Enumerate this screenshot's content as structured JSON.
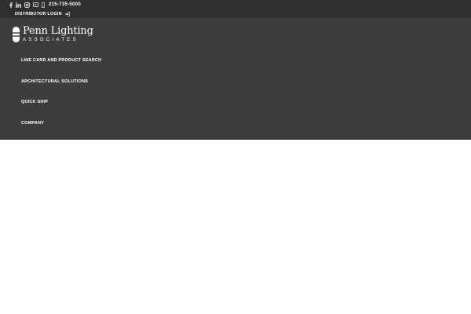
{
  "topbar": {
    "social_icons": [
      "facebook-icon",
      "linkedin-icon",
      "instagram-icon",
      "youtube-icon"
    ],
    "phone": "215-735-5000",
    "distributor_login": "DISTRIBUTOR LOGIN"
  },
  "logo": {
    "main": "Penn Lighting",
    "sub": "ASSOCIATES"
  },
  "nav": {
    "items": [
      {
        "label": "LINE CARD AND PRODUCT SEARCH"
      },
      {
        "label": "ARCHITECTURAL SOLUTIONS"
      },
      {
        "label": "QUICK SHIP"
      },
      {
        "label": "COMPANY"
      }
    ]
  },
  "colors": {
    "header_bg": "#3d3d3d",
    "topbar_bg": "#2f2f2f",
    "text": "#ffffff",
    "body_bg": "#ffffff"
  }
}
